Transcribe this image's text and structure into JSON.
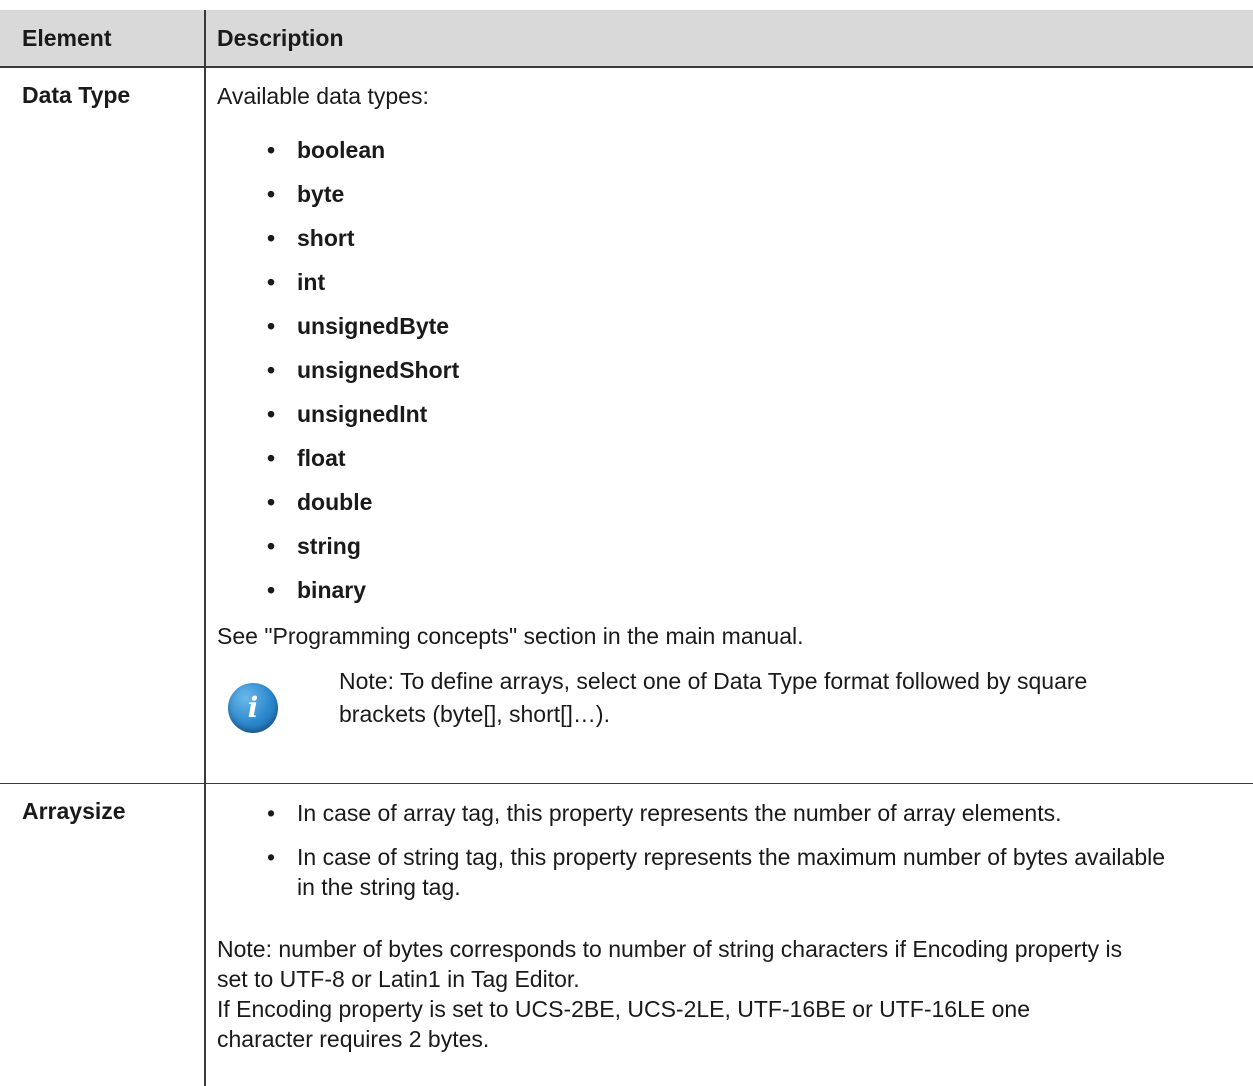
{
  "table": {
    "headers": {
      "element": "Element",
      "description": "Description"
    },
    "rows": [
      {
        "element": "Data Type",
        "intro": "Available data types:",
        "types": [
          "boolean",
          "byte",
          "short",
          "int",
          "unsignedByte",
          "unsignedShort",
          "unsignedInt",
          "float",
          "double",
          "string",
          "binary"
        ],
        "see_also": "See \"Programming concepts\" section in the main manual.",
        "note_icon": "info-icon",
        "note_icon_glyph": "i",
        "note_line1": "Note: To define arrays, select one of Data Type format followed by square",
        "note_line2": "brackets (byte[], short[]…)."
      },
      {
        "element": "Arraysize",
        "bullets": [
          "In case of array tag, this property represents the number of array elements.",
          "In case of string tag, this property represents the maximum number of bytes available in the string tag."
        ],
        "note_lines": [
          "Note: number of bytes corresponds to number of string characters if Encoding property is",
          "set to UTF-8 or Latin1 in Tag Editor.",
          "If Encoding property is set to UCS-2BE, UCS-2LE, UTF-16BE or UTF-16LE one",
          "character requires 2 bytes."
        ]
      }
    ]
  },
  "colors": {
    "header_bg": "#d9d9d9",
    "rule": "#3a3a3a",
    "info_icon": "#2a87cc"
  }
}
